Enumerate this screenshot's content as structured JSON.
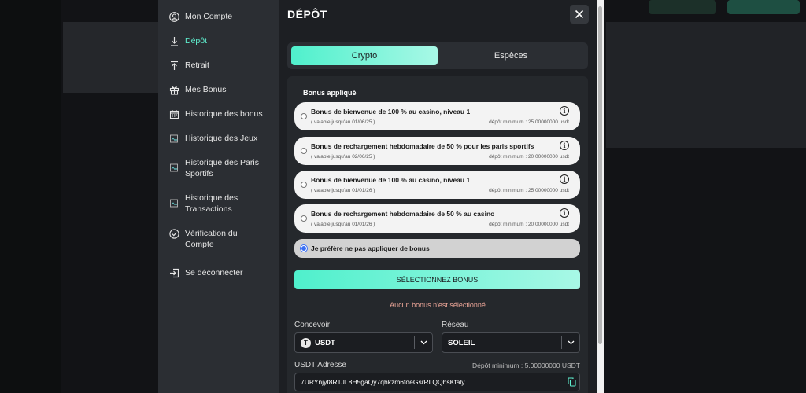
{
  "sidebar": {
    "items": [
      {
        "label": "Mon Compte",
        "icon": "user-circle-icon"
      },
      {
        "label": "Dépôt",
        "icon": "deposit-arrow-icon"
      },
      {
        "label": "Retrait",
        "icon": "withdraw-arrow-icon"
      },
      {
        "label": "Mes Bonus",
        "icon": "gift-icon"
      },
      {
        "label": "Historique des bonus",
        "icon": "calendar-icon"
      },
      {
        "label": "Historique des Jeux",
        "icon": "broken-image-icon"
      },
      {
        "label": "Historique des Paris Sportifs",
        "icon": "broken-image-icon"
      },
      {
        "label": "Historique des Transactions",
        "icon": "broken-image-icon"
      },
      {
        "label": "Vérification du Compte",
        "icon": "check-circle-icon"
      }
    ],
    "logout_label": "Se déconnecter"
  },
  "modal": {
    "title": "DÉPÔT",
    "tabs": [
      {
        "label": "Crypto",
        "active": true
      },
      {
        "label": "Espèces",
        "active": false
      }
    ],
    "bonus_heading": "Bonus appliqué",
    "bonuses": [
      {
        "name": "Bonus de bienvenue de 100 % au casino, niveau 1",
        "validity": "( valable jusqu'au 01/06/25 )",
        "minimum": "dépôt minimum : 25 00000000 usdt"
      },
      {
        "name": "Bonus de rechargement hebdomadaire de 50 % pour les paris sportifs",
        "validity": "( valable jusqu'au 02/06/25 )",
        "minimum": "dépôt minimum : 20 00000000 usdt"
      },
      {
        "name": "Bonus de bienvenue de 100 % au casino, niveau 1",
        "validity": "( valable jusqu'au 01/01/26 )",
        "minimum": "dépôt minimum : 25 00000000 usdt"
      },
      {
        "name": "Bonus de rechargement hebdomadaire de 50 % au casino",
        "validity": "( valable jusqu'au 01/01/26 )",
        "minimum": "dépôt minimum : 20 00000000 usdt"
      }
    ],
    "no_bonus_option": "Je préfère ne pas appliquer de bonus",
    "select_bonus_button": "SÉLECTIONNEZ BONUS",
    "no_bonus_message": "Aucun bonus n'est sélectionné",
    "currency_label": "Concevoir",
    "currency_value": "USDT",
    "network_label": "Réseau",
    "network_value": "SOLEIL",
    "address_label": "USDT Adresse",
    "min_deposit": "Dépôt minimum : 5.00000000 USDT",
    "address_value": "7URYnjyt8RTJL8H5gaQy7qhkzm6fdeGsrRLQQhsKfaly"
  },
  "colors": {
    "accent": "#4ff0cc",
    "active_nav": "#5ff0d0",
    "error_text": "#f0a89a",
    "radio_selected": "#3a6ff5"
  }
}
